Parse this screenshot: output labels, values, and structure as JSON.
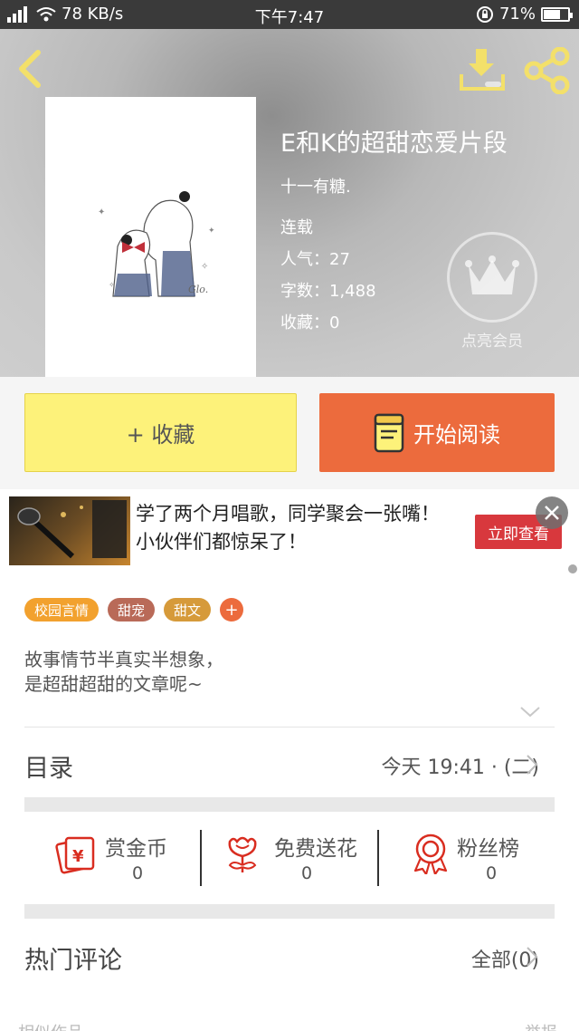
{
  "status_bar": {
    "network": "3G",
    "speed": "78 KB/s",
    "time": "下午7:47",
    "battery": "71%",
    "battery_level": 0.71
  },
  "book": {
    "title": "E和K的超甜恋爱片段",
    "author": "十一有糖.",
    "status": "连载",
    "popularity": "人气：27",
    "word_count": "字数：1,488",
    "favorites": "收藏：0",
    "vip_label": "点亮会员",
    "cover_signature": "Glo."
  },
  "actions": {
    "collect_label": "+ 收藏",
    "read_label": "开始阅读"
  },
  "ad": {
    "text": "学了两个月唱歌，同学聚会一张嘴！小伙伴们都惊呆了！",
    "cta": "立即查看"
  },
  "tags": [
    {
      "label": "校园言情",
      "color": "#f2a12e"
    },
    {
      "label": "甜宠",
      "color": "#b96a58"
    },
    {
      "label": "甜文",
      "color": "#d69a3a"
    }
  ],
  "description": {
    "line1": "故事情节半真实半想象，",
    "line2": "是超甜超甜的文章呢~"
  },
  "catalog": {
    "title": "目录",
    "update": "今天 19:41 · (二)"
  },
  "stats": [
    {
      "name": "赏金币",
      "value": "0",
      "icon": "red-envelope-icon"
    },
    {
      "name": "免费送花",
      "value": "0",
      "icon": "flower-icon"
    },
    {
      "name": "粉丝榜",
      "value": "0",
      "icon": "medal-icon"
    }
  ],
  "comments": {
    "title": "热门评论",
    "all": "全部(0)"
  },
  "cut_off": {
    "left": "相似作品",
    "right": "举报"
  },
  "colors": {
    "accent_yellow": "#fdf27a",
    "accent_orange": "#ec6b3d",
    "icon_yellow": "#f3e06a",
    "stat_red": "#d92d20"
  }
}
